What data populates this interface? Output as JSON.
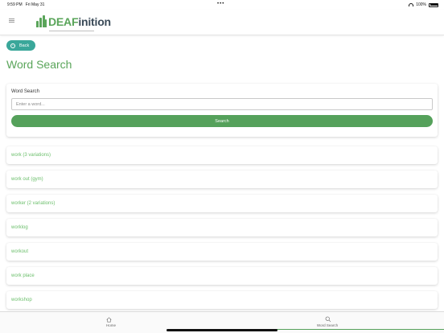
{
  "status_bar": {
    "time": "9:59 PM",
    "date": "Fri May 31",
    "battery": "100%"
  },
  "header": {
    "logo_part1": "DEAF",
    "logo_part2": "inition"
  },
  "back_label": "Back",
  "page_title": "Word Search",
  "search": {
    "label": "Word Search",
    "placeholder": "Enter a word...",
    "value": "",
    "button_label": "Search"
  },
  "results": [
    {
      "label": "work (3 variations)"
    },
    {
      "label": "work out (gym)"
    },
    {
      "label": "worker (2 variations)"
    },
    {
      "label": "worklog"
    },
    {
      "label": "workout"
    },
    {
      "label": "work place"
    },
    {
      "label": "workshop"
    }
  ],
  "tabs": [
    {
      "label": "Home",
      "icon": "home-icon",
      "active": false
    },
    {
      "label": "Word Search",
      "icon": "search-icon",
      "active": true
    }
  ],
  "colors": {
    "brand_green": "#5aa55a",
    "back_teal": "#3aa79a",
    "result_green": "#6cbf6c",
    "logo_dark": "#3a4a58"
  }
}
